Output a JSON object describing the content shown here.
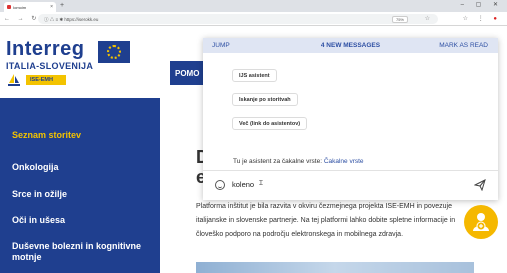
{
  "browser": {
    "tab_title": "Iomoim",
    "new_tab": "+",
    "nav_buttons": "← → ↻ ⌂",
    "url": "ⓘ △ ≡ ✱ https://iserokk.eu",
    "zoom": "75%",
    "window_controls": "– ▢ ✕",
    "ext_icons": "☆ ⋮"
  },
  "site": {
    "logo_title": "Interreg",
    "logo_subtitle": "ITALIA-SLOVENIJA",
    "logo_badge": "ISE-EMH",
    "help_button": "POMO"
  },
  "sidebar": {
    "items": [
      {
        "label": "Seznam storitev",
        "active": true
      },
      {
        "label": "Onkologija",
        "active": false
      },
      {
        "label": "Srce in ožilje",
        "active": false
      },
      {
        "label": "Oči in ušesa",
        "active": false
      },
      {
        "label": "Duševne bolezni in kognitivne motnje",
        "active": false
      }
    ]
  },
  "content": {
    "title_line1": "D",
    "title_line2": "e",
    "paragraph": "Platforma inštitut je bila razvita v okviru čezmejnega projekta ISE-EMH in povezuje italijanske in slovenske partnerje. Na tej platformi lahko dobite spletne informacije in človeško podporo na področju elektronskega in mobilnega zdravja."
  },
  "chat": {
    "jump": "JUMP",
    "new_messages": "4 NEW MESSAGES",
    "mark_as_read": "MARK AS READ",
    "quick_replies": [
      "IJS asistent",
      "Iskanje po storitvah",
      "Več (link do asistentov)"
    ],
    "queue_text": "Tu je asistent za čakalne vrste: ",
    "queue_link": "Čakalne vrste",
    "input_value": "koleno",
    "caret": "Ɪ"
  },
  "colors": {
    "brand_blue": "#1f3f8f",
    "accent_yellow": "#f3c300",
    "fab": "#f5b800"
  }
}
